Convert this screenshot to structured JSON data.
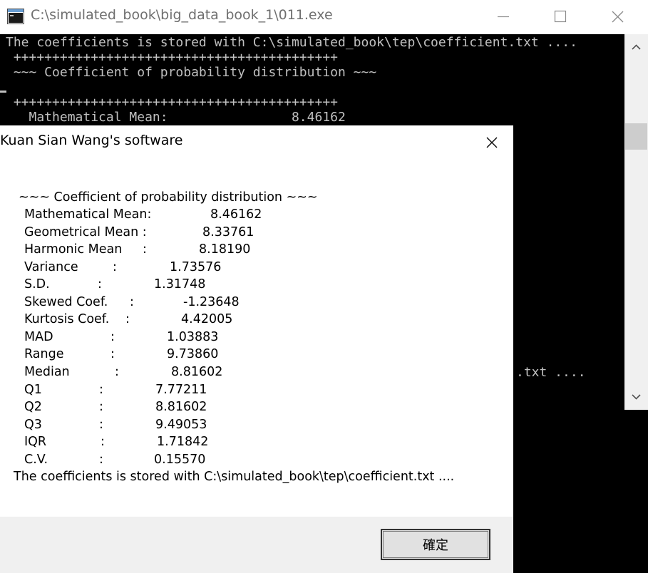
{
  "console": {
    "title": "C:\\simulated_book\\big_data_book_1\\011.exe",
    "lines": [
      "The coefficients is stored with C:\\simulated_book\\tep\\coefficient.txt ....",
      " ++++++++++++++++++++++++++++++++++++++++++",
      " ~~~ Coefficient of probability distribution ~~~",
      "",
      " ++++++++++++++++++++++++++++++++++++++++++",
      "   Mathematical Mean:                8.46162"
    ],
    "tail_fragment": ".txt ...."
  },
  "dialog": {
    "title": "Kuan Sian Wang's software",
    "heading": "~~~ Coefficient of probability distribution ~~~",
    "stats": [
      {
        "label": "Mathematical Mean:",
        "sep": "",
        "value": "8.46162"
      },
      {
        "label": "Geometrical Mean :",
        "sep": "",
        "value": "8.33761"
      },
      {
        "label": "Harmonic Mean",
        "sep": ":",
        "value": "8.18190"
      },
      {
        "label": "Variance",
        "sep": ":",
        "value": "1.73576"
      },
      {
        "label": "S.D.",
        "sep": ":",
        "value": "1.31748"
      },
      {
        "label": "Skewed Coef.",
        "sep": ":",
        "value": "-1.23648"
      },
      {
        "label": "Kurtosis Coef.",
        "sep": ":",
        "value": "4.42005"
      },
      {
        "label": "MAD",
        "sep": ":",
        "value": "1.03883"
      },
      {
        "label": "Range",
        "sep": ":",
        "value": "9.73860"
      },
      {
        "label": "Median",
        "sep": ":",
        "value": "8.81602"
      },
      {
        "label": "Q1",
        "sep": ":",
        "value": "7.77211"
      },
      {
        "label": "Q2",
        "sep": ":",
        "value": "8.81602"
      },
      {
        "label": "Q3",
        "sep": ":",
        "value": "9.49053"
      },
      {
        "label": "IQR",
        "sep": ":",
        "value": "1.71842"
      },
      {
        "label": "C.V.",
        "sep": ":",
        "value": "0.15570"
      }
    ],
    "footer_message": "The coefficients is stored with C:\\simulated_book\\tep\\coefficient.txt ....",
    "ok_label": "確定"
  },
  "colors": {
    "console_bg": "#000000",
    "console_text": "#c0c0c0",
    "dialog_footer_bg": "#f0f0f0",
    "title_text": "#6f6f6f"
  },
  "icons": {
    "app": "console-app-icon",
    "minimize": "minimize-icon",
    "maximize": "maximize-icon",
    "close": "close-icon",
    "scroll_up": "chevron-up-icon",
    "scroll_down": "chevron-down-icon"
  }
}
